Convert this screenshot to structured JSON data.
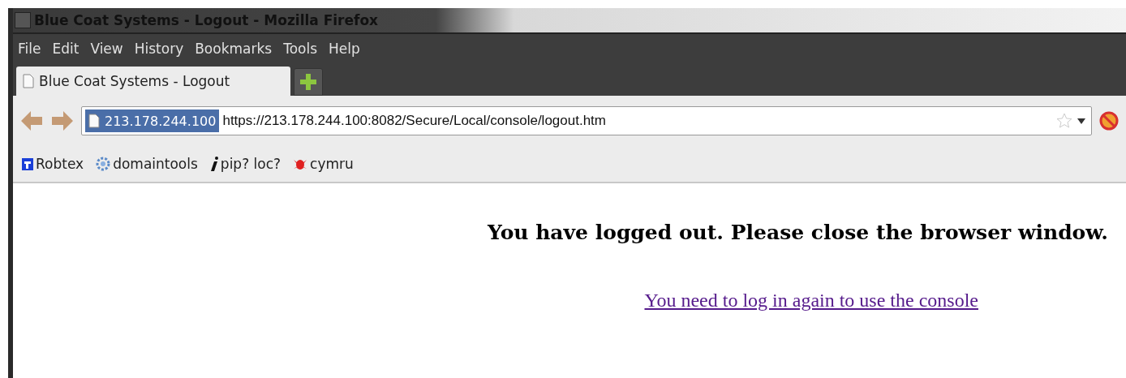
{
  "window": {
    "title": "Blue Coat Systems - Logout - Mozilla Firefox"
  },
  "menu": [
    "File",
    "Edit",
    "View",
    "History",
    "Bookmarks",
    "Tools",
    "Help"
  ],
  "tabs": [
    {
      "label": "Blue Coat Systems - Logout",
      "selected": true
    }
  ],
  "address": {
    "identity": "213.178.244.100",
    "url": "https://213.178.244.100:8082/Secure/Local/console/logout.htm"
  },
  "bookmarks": [
    {
      "label": "Robtex",
      "kind": "robtex"
    },
    {
      "label": "domaintools",
      "kind": "gear"
    },
    {
      "label": "pip? loc?",
      "kind": "info"
    },
    {
      "label": "cymru",
      "kind": "bug"
    }
  ],
  "page": {
    "message": "You have logged out. Please close the browser window.",
    "link": "You need to log in again to use the console"
  }
}
